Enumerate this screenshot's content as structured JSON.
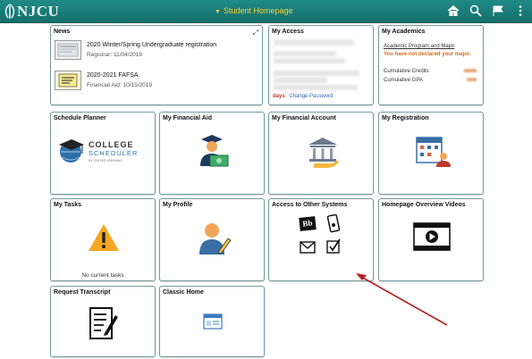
{
  "topbar": {
    "logo_text": "NJCU",
    "page_title": "Student Homepage",
    "icons": [
      "home-icon",
      "search-icon",
      "flag-icon",
      "more-icon"
    ]
  },
  "tiles": {
    "news": {
      "title": "News",
      "items": [
        {
          "headline": "2020 Winter/Spring Undergraduate registration",
          "detail": "Registrar: 11/04/2019"
        },
        {
          "headline": "2020-2021 FAFSA",
          "detail": "Financial Aid: 10/15/2019"
        }
      ]
    },
    "my_access": {
      "title": "My Access",
      "days_label": "days",
      "change_password": "Change Password"
    },
    "my_academics": {
      "title": "My Academics",
      "program_link": "Academic Program and Major",
      "warning": "You have not declared your major.",
      "credits_label": "Cumulative Credits",
      "gpa_label": "Cumulative GPA"
    },
    "schedule_planner": {
      "title": "Schedule Planner",
      "logo_line1": "COLLEGE",
      "logo_line2": "SCHEDULER",
      "logo_line3": "BY CIVITAS LEARNING"
    },
    "my_financial_aid": {
      "title": "My Financial Aid"
    },
    "my_financial_account": {
      "title": "My Financial Account"
    },
    "my_registration": {
      "title": "My Registration"
    },
    "my_tasks": {
      "title": "My Tasks",
      "empty_text": "No current tasks"
    },
    "my_profile": {
      "title": "My Profile"
    },
    "access_other_systems": {
      "title": "Access to Other Systems",
      "bb_text": "Bb"
    },
    "homepage_videos": {
      "title": "Homepage Overview Videos"
    },
    "request_transcript": {
      "title": "Request Transcript"
    },
    "classic_home": {
      "title": "Classic Home"
    }
  },
  "colors": {
    "topbar": "#1a7d79",
    "title_yellow": "#f3d23a",
    "tile_border": "#6f9b98",
    "warning_orange": "#d06a19",
    "link_blue": "#2b63b8",
    "arrow_red": "#b22222"
  }
}
